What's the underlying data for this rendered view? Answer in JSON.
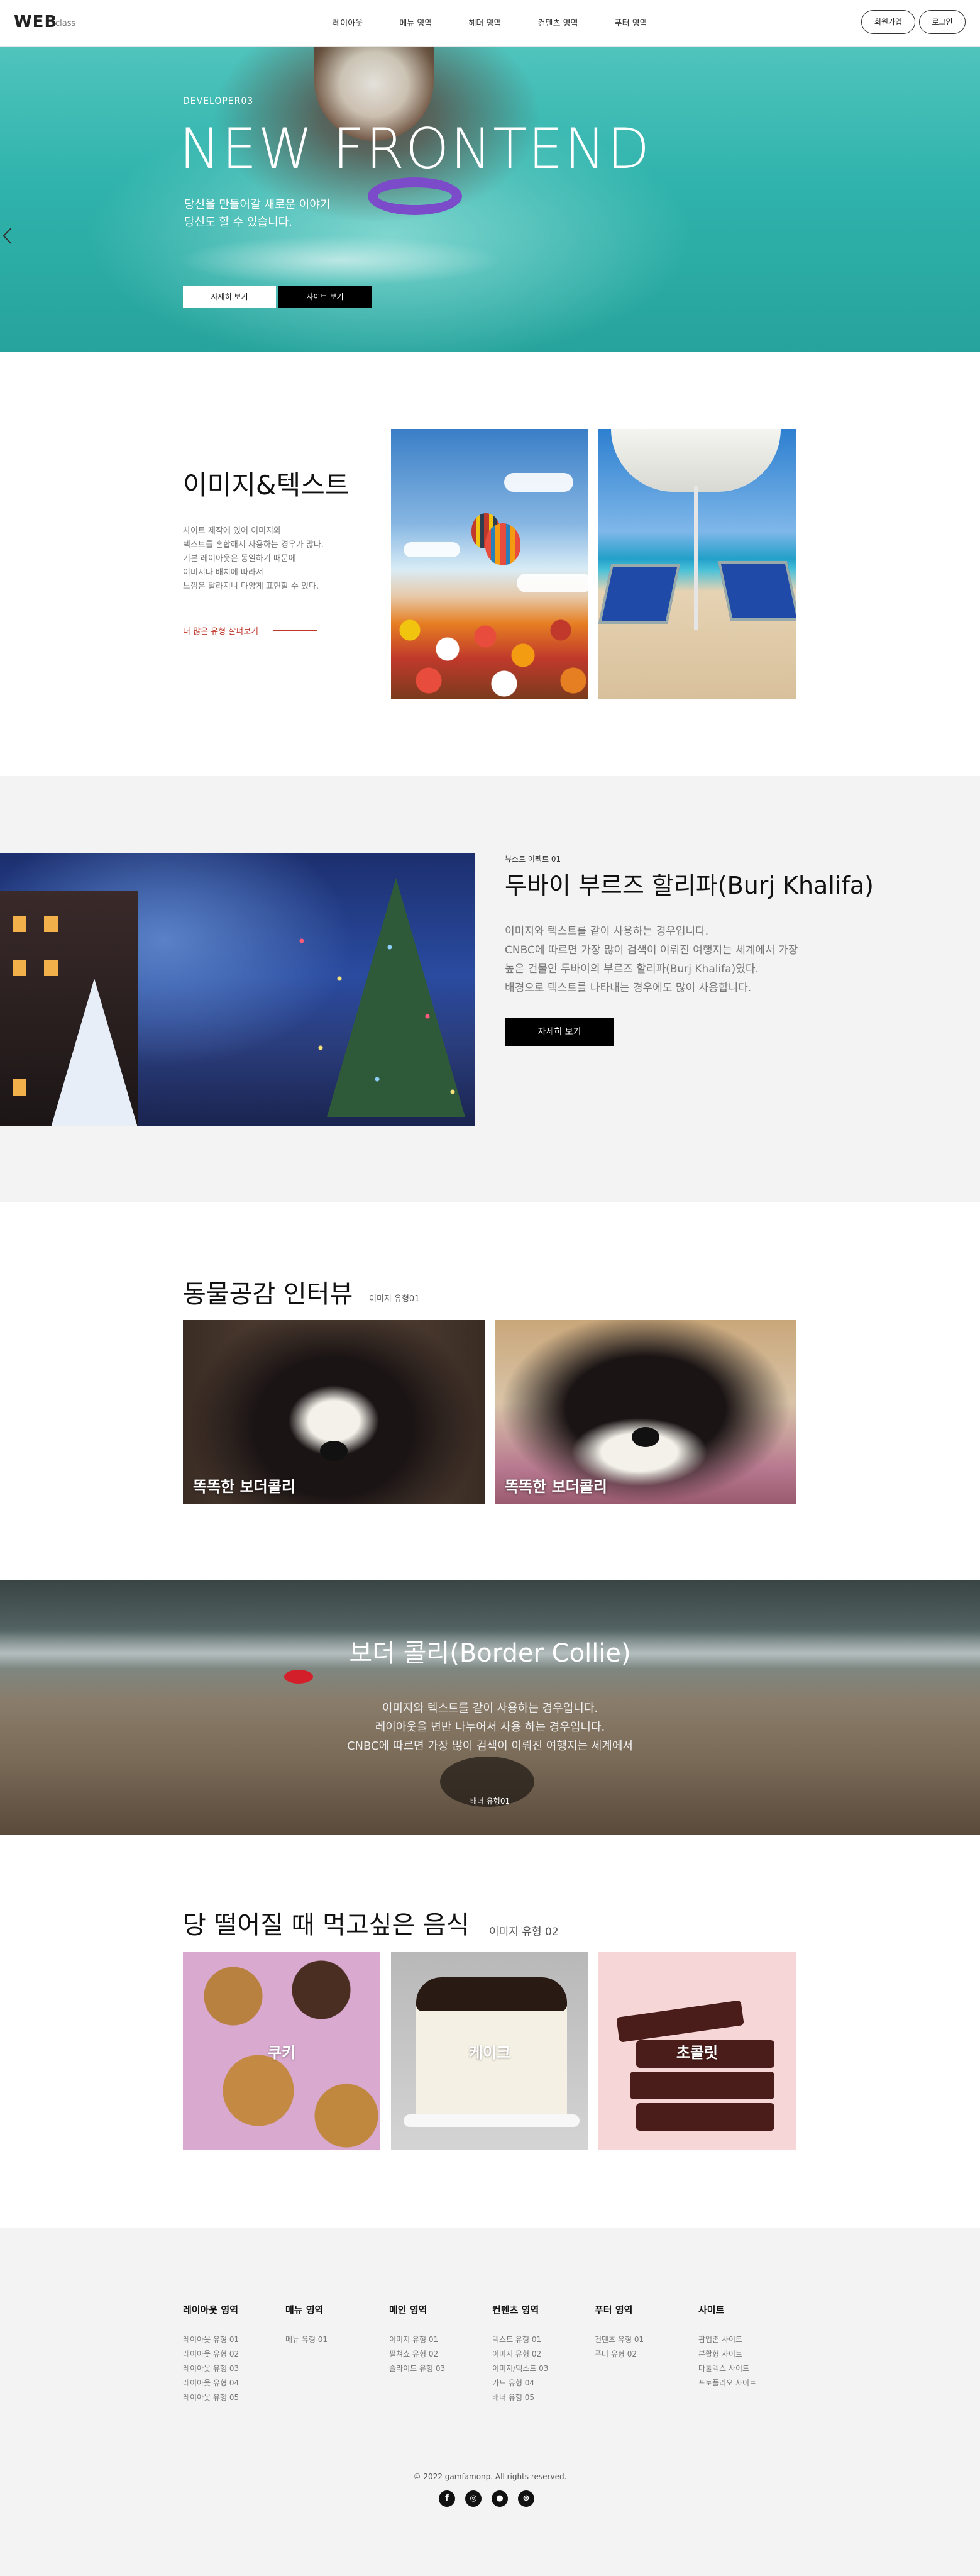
{
  "header": {
    "logo": "WEB",
    "logo_sub": "class",
    "nav": [
      "레이아웃",
      "메뉴 영역",
      "헤더 영역",
      "컨텐츠 영역",
      "푸터 영역"
    ],
    "signup": "회원가입",
    "login": "로그인"
  },
  "hero": {
    "small": "DEVELOPER03",
    "title": "NEW FRONTEND",
    "desc_line1": "당신을 만들어갈 새로운 이야기",
    "desc_line2": "당신도 할 수 있습니다.",
    "btn_detail": "자세히 보기",
    "btn_site": "사이트 보기",
    "slides": 3,
    "active_slide": 3
  },
  "section1": {
    "title": "이미지&텍스트",
    "desc": [
      "사이트 제작에 있어 이미지와",
      "텍스트를 혼합해서 사용하는 경우가 많다.",
      "기본 레이아웃은 동일하기 때문에",
      "이미지나 배치에 따라서",
      "느낌은 달라지니 다양게 표현할 수 있다."
    ],
    "more": "더 많은 유형 살펴보기"
  },
  "section2": {
    "small": "뷰스트 이펙트 01",
    "title": "두바이 부르즈 할리파(Burj Khalifa)",
    "desc": [
      "이미지와 텍스트를 같이 사용하는 경우입니다.",
      "CNBC에 따르면 가장 많이 검색이 이뤄진 여행지는 세계에서 가장",
      "높은 건물인 두바이의 부르즈 할리파(Burj Khalifa)였다.",
      "배경으로 텍스트를 나타내는 경우에도 많이 사용합니다."
    ],
    "btn": "자세히 보기"
  },
  "section3": {
    "title": "동물공감 인터뷰",
    "sub": "이미지 유형01",
    "cards": [
      "똑똑한 보더콜리",
      "똑똑한 보더콜리"
    ]
  },
  "section4": {
    "title": "보더 콜리(Border Collie)",
    "desc": [
      "이미지와 텍스트를 같이 사용하는 경우입니다.",
      "레이아웃을 변반 나누어서 사용 하는 경우입니다.",
      "CNBC에 따르면 가장 많이 검색이 이뤄진 여행지는 세계에서"
    ],
    "link": "배너 유형01"
  },
  "section5": {
    "title": "당 떨어질 때 먹고싶은 음식",
    "sub": "이미지 유형 02",
    "foods": [
      "쿠키",
      "케이크",
      "초콜릿"
    ]
  },
  "footer": {
    "columns": [
      {
        "title": "레이아웃 영역",
        "items": [
          "레이아웃 유형 01",
          "레이아웃 유형 02",
          "레이아웃 유형 03",
          "레이아웃 유형 04",
          "레이아웃 유형 05"
        ]
      },
      {
        "title": "메뉴 영역",
        "items": [
          "메뉴 유형 01"
        ]
      },
      {
        "title": "메인 영역",
        "items": [
          "이미지 유형 01",
          "펼쳐쇼 유형 02",
          "슬라이드 유형 03"
        ]
      },
      {
        "title": "컨텐츠 영역",
        "items": [
          "텍스트 유형 01",
          "이미지 유형 02",
          "이미지/텍스트 03",
          "카드 유형 04",
          "배너 유형 05"
        ]
      },
      {
        "title": "푸터 영역",
        "items": [
          "컨텐츠 유형 01",
          "푸터 유형 02"
        ]
      },
      {
        "title": "사이트",
        "items": [
          "팝업존 사이트",
          "분활형 사이트",
          "마툴렉스 사이트",
          "포토폴리오 사이트"
        ]
      }
    ],
    "copyright": "© 2022 gamfamonp. All rights reserved.",
    "social": [
      "facebook-icon",
      "instagram-icon",
      "github-icon",
      "dribbble-icon"
    ]
  }
}
